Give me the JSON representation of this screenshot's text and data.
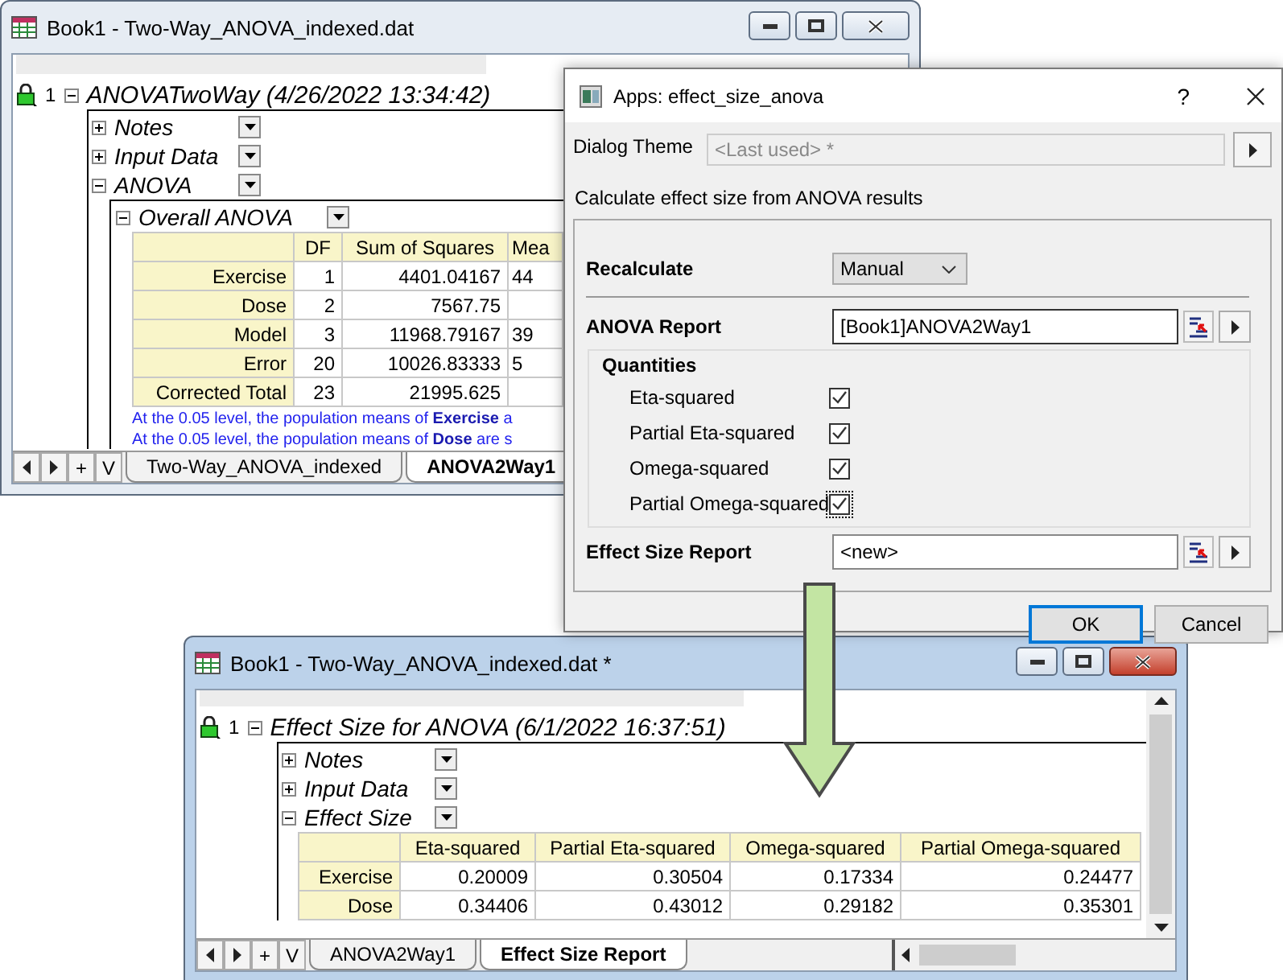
{
  "report_window": {
    "title": "Book1 - Two-Way_ANOVA_indexed.dat",
    "report": {
      "index": "1",
      "title": "ANOVATwoWay (4/26/2022 13:34:42)",
      "expanded": true,
      "sections": [
        {
          "title": "Notes",
          "expanded": false
        },
        {
          "title": "Input Data",
          "expanded": false
        },
        {
          "title": "ANOVA",
          "expanded": true,
          "children": [
            {
              "title": "Overall ANOVA",
              "expanded": true,
              "table": {
                "columns": [
                  "DF",
                  "Sum of Squares",
                  "Mea"
                ],
                "rows": [
                  {
                    "label": "Exercise",
                    "cells": [
                      "1",
                      "4401.04167",
                      "44"
                    ]
                  },
                  {
                    "label": "Dose",
                    "cells": [
                      "2",
                      "7567.75",
                      ""
                    ]
                  },
                  {
                    "label": "Model",
                    "cells": [
                      "3",
                      "11968.79167",
                      "39"
                    ]
                  },
                  {
                    "label": "Error",
                    "cells": [
                      "20",
                      "10026.83333",
                      "5"
                    ]
                  },
                  {
                    "label": "Corrected Total",
                    "cells": [
                      "23",
                      "21995.625",
                      ""
                    ]
                  }
                ]
              },
              "notes": [
                "At the 0.05 level, the population means of **Exercise** a",
                "At the 0.05 level, the population means of **Dose** are s"
              ]
            }
          ]
        }
      ]
    },
    "nav_buttons": [
      "+",
      "V"
    ],
    "sheet_tabs": [
      {
        "label": "Two-Way_ANOVA_indexed",
        "selected": false
      },
      {
        "label": "ANOVA2Way1",
        "selected": true
      }
    ]
  },
  "dialog": {
    "title": "Apps: effect_size_anova",
    "help": "?",
    "theme": {
      "label": "Dialog Theme",
      "value": "<Last used> *",
      "disabled": true
    },
    "description": "Calculate effect size from ANOVA results",
    "recalculate": {
      "label": "Recalculate",
      "value": "Manual"
    },
    "anova_report": {
      "label": "ANOVA Report",
      "value": "[Book1]ANOVA2Way1"
    },
    "quantities": {
      "title": "Quantities",
      "items": [
        {
          "label": "Eta-squared",
          "checked": true,
          "focused": false
        },
        {
          "label": "Partial Eta-squared",
          "checked": true,
          "focused": false
        },
        {
          "label": "Omega-squared",
          "checked": true,
          "focused": false
        },
        {
          "label": "Partial Omega-squared",
          "checked": true,
          "focused": true
        }
      ]
    },
    "effect_size_report": {
      "label": "Effect Size Report",
      "value": "<new>"
    },
    "buttons": [
      {
        "label": "OK",
        "default": true
      },
      {
        "label": "Cancel",
        "default": false
      }
    ]
  },
  "result_window": {
    "title": "Book1 - Two-Way_ANOVA_indexed.dat *",
    "report": {
      "index": "1",
      "title": "Effect Size for ANOVA (6/1/2022 16:37:51)",
      "expanded": true,
      "sections": [
        {
          "title": "Notes",
          "expanded": false
        },
        {
          "title": "Input Data",
          "expanded": false
        },
        {
          "title": "Effect Size",
          "expanded": true,
          "table": {
            "columns": [
              "Eta-squared",
              "Partial Eta-squared",
              "Omega-squared",
              "Partial Omega-squared"
            ],
            "rows": [
              {
                "label": "Exercise",
                "cells": [
                  "0.20009",
                  "0.30504",
                  "0.17334",
                  "0.24477"
                ]
              },
              {
                "label": "Dose",
                "cells": [
                  "0.34406",
                  "0.43012",
                  "0.29182",
                  "0.35301"
                ]
              }
            ]
          }
        }
      ]
    },
    "nav_buttons": [
      "+",
      "V"
    ],
    "sheet_tabs": [
      {
        "label": "ANOVA2Way1",
        "selected": false
      },
      {
        "label": "Effect Size Report",
        "selected": true
      }
    ]
  }
}
